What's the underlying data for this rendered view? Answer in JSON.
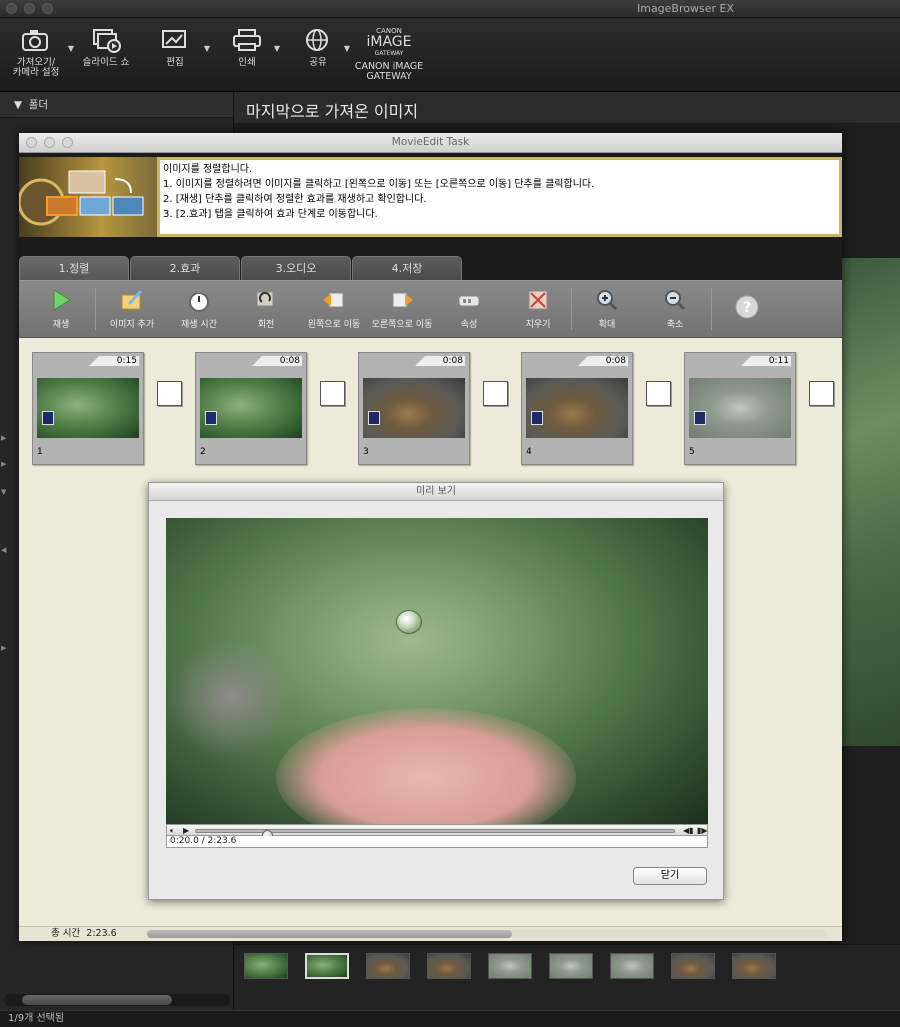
{
  "app": {
    "title": "ImageBrowser EX",
    "toolbar": [
      {
        "label_l1": "가져오기/",
        "label_l2": "카메라 설정",
        "icon": "camera-import-icon"
      },
      {
        "label_l1": "슬라이드 쇼",
        "label_l2": "",
        "icon": "slideshow-icon"
      },
      {
        "label_l1": "편집",
        "label_l2": "",
        "icon": "edit-icon"
      },
      {
        "label_l1": "인쇄",
        "label_l2": "",
        "icon": "printer-icon"
      },
      {
        "label_l1": "공유",
        "label_l2": "",
        "icon": "globe-share-icon"
      },
      {
        "label_l1": "CANON iMAGE",
        "label_l2": "GATEWAY",
        "icon": "canon-image-gateway-logo"
      }
    ],
    "sidebar": {
      "folder_header": "폴더"
    },
    "content_title": "마지막으로 가져온 이미지",
    "status": "1/9개 선택됨",
    "filmstrip_count": 9,
    "filmstrip_selected": 2
  },
  "movie": {
    "title": "MovieEdit Task",
    "instructions": [
      "이미지를 정렬합니다.",
      "1. 이미지를 정렬하려면 이미지를 클릭하고 [왼쪽으로 이동] 또는 [오른쪽으로 이동] 단추를 클릭합니다.",
      "2. [재생] 단추를 클릭하여 정렬한 효과를 재생하고 확인합니다.",
      "3. [2.효과] 탭을 클릭하여 효과 단계로 이동합니다."
    ],
    "tabs": [
      "1.정렬",
      "2.효과",
      "3.오디오",
      "4.저장"
    ],
    "toolbar": [
      {
        "label": "재생",
        "icon": "play-icon"
      },
      {
        "label": "이미지 추가",
        "icon": "add-image-icon"
      },
      {
        "label": "재생 시간",
        "icon": "stopwatch-icon"
      },
      {
        "label": "회전",
        "icon": "rotate-icon"
      },
      {
        "label": "왼쪽으로 이동",
        "icon": "move-left-icon"
      },
      {
        "label": "오른쪽으로 이동",
        "icon": "move-right-icon"
      },
      {
        "label": "속성",
        "icon": "properties-icon"
      },
      {
        "label": "지우기",
        "icon": "delete-icon"
      },
      {
        "label": "확대",
        "icon": "zoom-in-icon"
      },
      {
        "label": "축소",
        "icon": "zoom-out-icon"
      },
      {
        "label": "",
        "icon": "help-icon"
      }
    ],
    "clips": [
      {
        "num": "1",
        "duration": "0:15",
        "kind": "leaf"
      },
      {
        "num": "2",
        "duration": "0:08",
        "kind": "leaf"
      },
      {
        "num": "3",
        "duration": "0:08",
        "kind": "drink"
      },
      {
        "num": "4",
        "duration": "0:08",
        "kind": "drink"
      },
      {
        "num": "5",
        "duration": "0:11",
        "kind": "town"
      }
    ],
    "preview": {
      "title": "미리 보기",
      "time": "0:20.0 / 2:23.6",
      "progress": 0.14,
      "close_label": "닫기"
    },
    "status": {
      "total_label": "총 시간",
      "total_value": "2:23.6"
    }
  }
}
